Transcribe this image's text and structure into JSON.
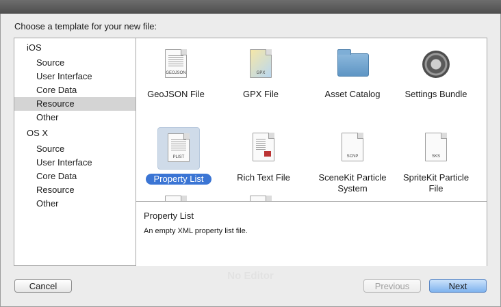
{
  "dialog": {
    "prompt": "Choose a template for your new file:",
    "ghost_label": "No Editor"
  },
  "sidebar": {
    "groups": [
      {
        "label": "iOS",
        "items": [
          "Source",
          "User Interface",
          "Core Data",
          "Resource",
          "Other"
        ]
      },
      {
        "label": "OS X",
        "items": [
          "Source",
          "User Interface",
          "Core Data",
          "Resource",
          "Other"
        ]
      }
    ],
    "selected": "iOS / Resource"
  },
  "templates": {
    "row1": [
      {
        "label": "GeoJSON File",
        "icon": "geojson-file-icon",
        "tag": "GEOJSON"
      },
      {
        "label": "GPX File",
        "icon": "gpx-file-icon",
        "tag": "GPX"
      },
      {
        "label": "Asset Catalog",
        "icon": "folder-icon"
      },
      {
        "label": "Settings Bundle",
        "icon": "gear-icon"
      }
    ],
    "row2": [
      {
        "label": "Property List",
        "icon": "plist-file-icon",
        "tag": "PLIST"
      },
      {
        "label": "Rich Text File",
        "icon": "rtf-file-icon"
      },
      {
        "label": "SceneKit Particle System",
        "icon": "scnp-file-icon",
        "tag": "SCNP"
      },
      {
        "label": "SpriteKit Particle File",
        "icon": "sks-file-icon",
        "tag": "SKS"
      }
    ],
    "selected": "Property List"
  },
  "detail": {
    "title": "Property List",
    "description": "An empty XML property list file."
  },
  "buttons": {
    "cancel": "Cancel",
    "previous": "Previous",
    "next": "Next"
  },
  "colors": {
    "selection_blue": "#3b75d4",
    "sidebar_selection": "#d4d4d4"
  }
}
